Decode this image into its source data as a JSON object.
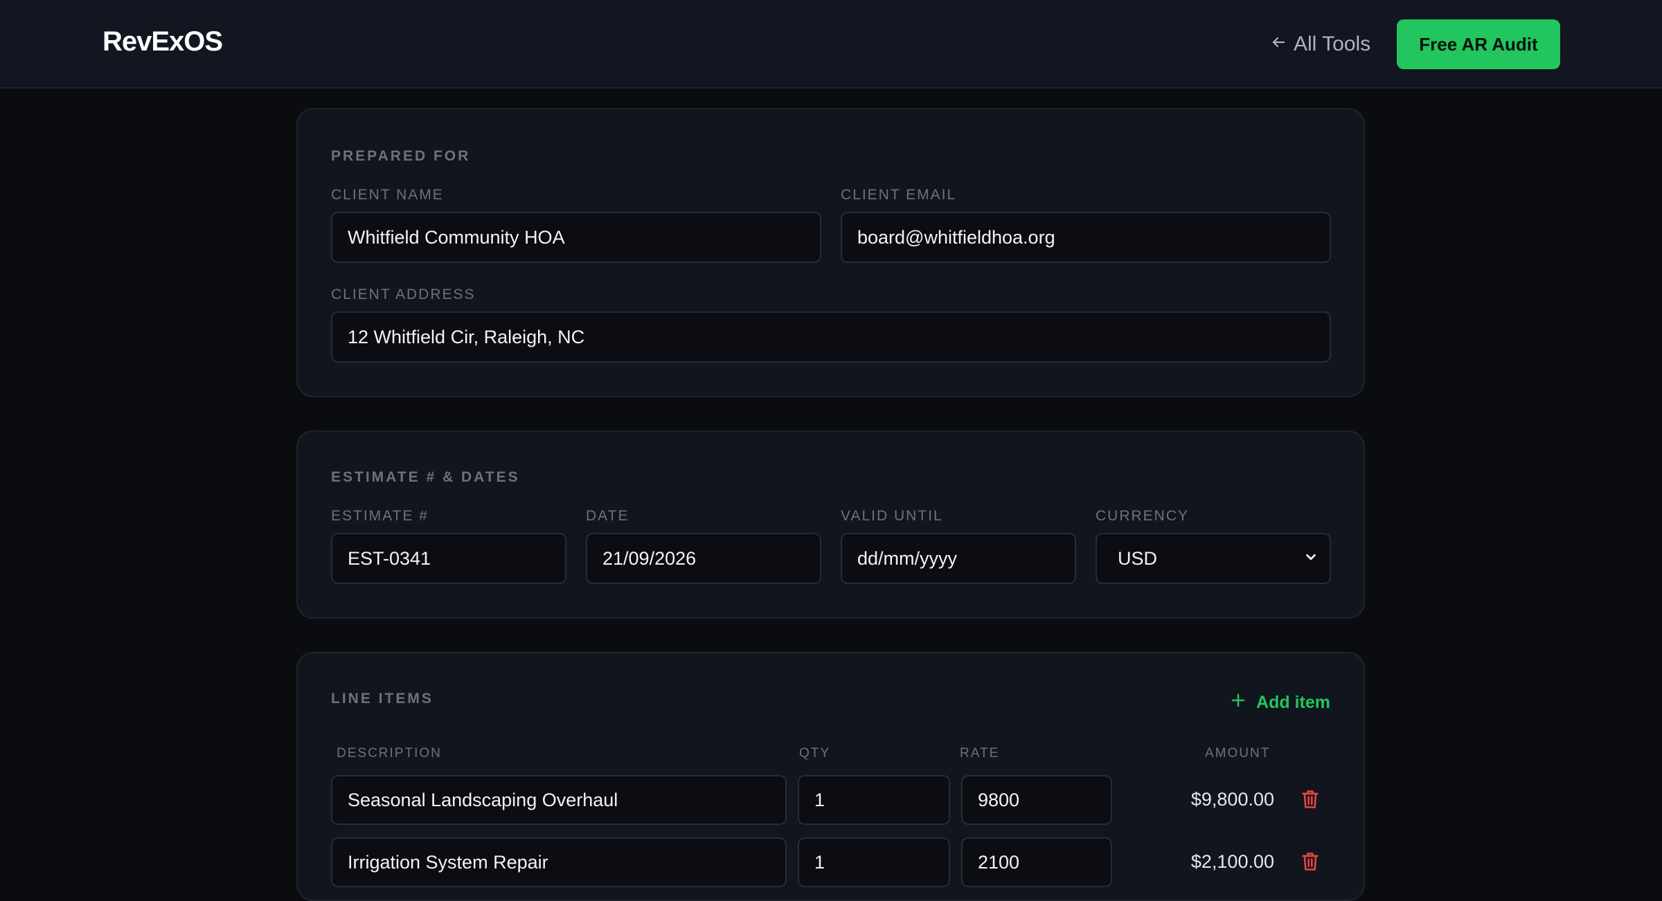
{
  "header": {
    "brand": "RevExOS",
    "back_label": "All Tools",
    "cta_label": "Free AR Audit"
  },
  "prepared_for": {
    "title": "PREPARED FOR",
    "client_name_label": "CLIENT NAME",
    "client_name_value": "Whitfield Community HOA",
    "client_email_label": "CLIENT EMAIL",
    "client_email_value": "board@whitfieldhoa.org",
    "client_address_label": "CLIENT ADDRESS",
    "client_address_value": "12 Whitfield Cir, Raleigh, NC"
  },
  "estimate": {
    "title": "ESTIMATE # & DATES",
    "number_label": "ESTIMATE #",
    "number_value": "EST-0341",
    "date_label": "DATE",
    "date_value": "21/09/2026",
    "valid_label": "VALID UNTIL",
    "valid_placeholder": "dd/mm/yyyy",
    "currency_label": "CURRENCY",
    "currency_value": "USD"
  },
  "line_items": {
    "title": "LINE ITEMS",
    "add_label": "Add item",
    "columns": {
      "description": "DESCRIPTION",
      "qty": "QTY",
      "rate": "RATE",
      "amount": "AMOUNT"
    },
    "rows": [
      {
        "description": "Seasonal Landscaping Overhaul",
        "qty": "1",
        "rate": "9800",
        "amount": "$9,800.00"
      },
      {
        "description": "Irrigation System Repair",
        "qty": "1",
        "rate": "2100",
        "amount": "$2,100.00"
      }
    ]
  },
  "colors": {
    "accent": "#22c55e",
    "danger": "#ef4444",
    "background": "#0a0c10",
    "card": "#11151d"
  }
}
